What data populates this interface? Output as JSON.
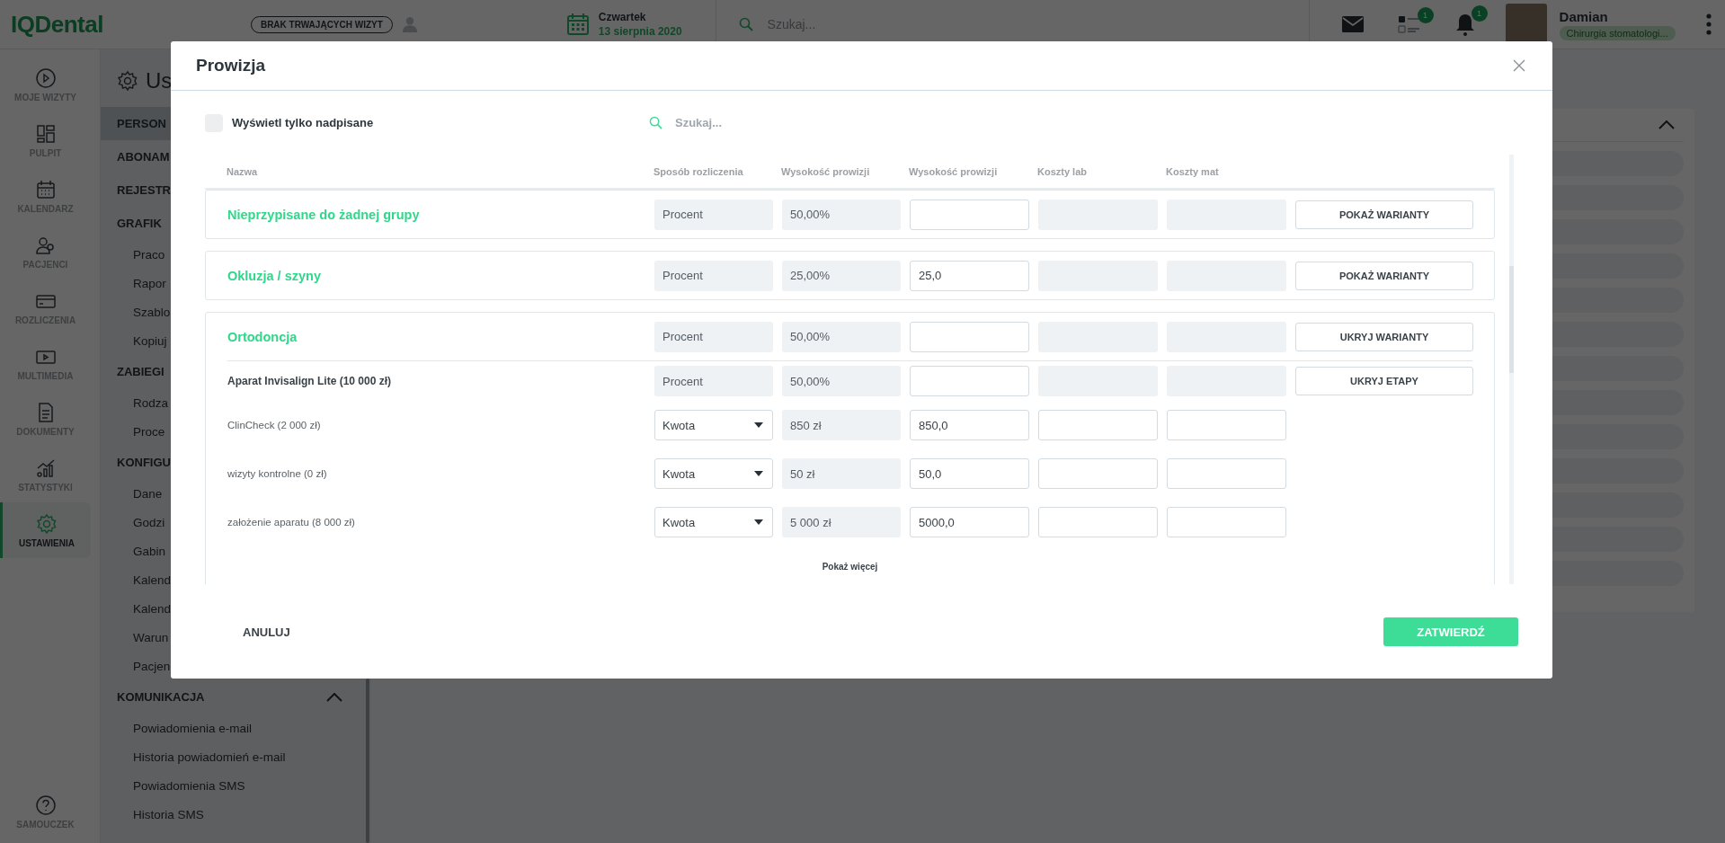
{
  "topbar": {
    "logo": "IQDental",
    "visit_status": "BRAK TRWAJĄCYCH WIZYT",
    "weekday": "Czwartek",
    "date": "13 sierpnia 2020",
    "search": {
      "placeholder": "Szukaj..."
    },
    "tasks_badge": "1",
    "notifications_badge": "1",
    "user": {
      "name": "Damian",
      "role": "Chirurgia stomatologi..."
    }
  },
  "nav": [
    {
      "label": "MOJE WIZYTY",
      "selected": false
    },
    {
      "label": "PULPIT",
      "selected": false
    },
    {
      "label": "KALENDARZ",
      "selected": false
    },
    {
      "label": "PACJENCI",
      "selected": false
    },
    {
      "label": "ROZLICZENIA",
      "selected": false
    },
    {
      "label": "MULTIMEDIA",
      "selected": false
    },
    {
      "label": "DOKUMENTY",
      "selected": false
    },
    {
      "label": "STATYSTYKI",
      "selected": false
    },
    {
      "label": "USTAWIENIA",
      "selected": true
    }
  ],
  "help": {
    "label": "SAMOUCZEK"
  },
  "settings_sidebar": {
    "title": "Us",
    "items": [
      {
        "label": "PERSON",
        "kind": "section",
        "selected": true
      },
      {
        "label": "ABONAM",
        "kind": "section",
        "selected": false
      },
      {
        "label": "REJESTR",
        "kind": "section",
        "selected": false
      },
      {
        "label": "GRAFIK",
        "kind": "section",
        "selected": false
      },
      {
        "label": "Praco",
        "kind": "link",
        "selected": false
      },
      {
        "label": "Rapor",
        "kind": "link",
        "selected": false
      },
      {
        "label": "Szablo",
        "kind": "link",
        "selected": false
      },
      {
        "label": "Kopiuj",
        "kind": "link",
        "selected": false
      },
      {
        "label": "ZABIEGI",
        "kind": "section",
        "selected": false
      },
      {
        "label": "Rodza",
        "kind": "link",
        "selected": false
      },
      {
        "label": "Proce",
        "kind": "link",
        "selected": false
      },
      {
        "label": "KONFIGU",
        "kind": "section",
        "selected": false
      },
      {
        "label": "Dane",
        "kind": "link",
        "selected": false
      },
      {
        "label": "Godzi",
        "kind": "link",
        "selected": false
      },
      {
        "label": "Gabin",
        "kind": "link",
        "selected": false
      },
      {
        "label": "Kalend",
        "kind": "link",
        "selected": false
      },
      {
        "label": "Kalend",
        "kind": "link",
        "selected": false
      },
      {
        "label": "Warun",
        "kind": "link",
        "selected": false
      },
      {
        "label": "Pacjen",
        "kind": "link",
        "selected": false
      },
      {
        "label": "KOMUNIKACJA",
        "kind": "section",
        "selected": false,
        "expanded": true
      },
      {
        "label": "Powiadomienia e-mail",
        "kind": "link",
        "selected": false
      },
      {
        "label": "Historia powiadomień e-mail",
        "kind": "link",
        "selected": false
      },
      {
        "label": "Powiadomienia SMS",
        "kind": "link",
        "selected": false
      },
      {
        "label": "Historia SMS",
        "kind": "link",
        "selected": false
      }
    ]
  },
  "modal": {
    "title": "Prowizja",
    "filter": {
      "label": "Wyświetl tylko nadpisane",
      "checked": false
    },
    "search": {
      "placeholder": "Szukaj..."
    },
    "columns": [
      "Nazwa",
      "Sposób rozliczenia",
      "Wysokość prowizji",
      "Wysokość prowizji",
      "Koszty lab",
      "Koszty mat"
    ],
    "groups": [
      {
        "name": "Nieprzypisane do żadnej grupy",
        "method": "Procent",
        "commission": "50,00%",
        "button": "POKAŻ WARIANTY"
      },
      {
        "name": "Okluzja / szyny",
        "method": "Procent",
        "commission": "25,00%",
        "override": "25,0",
        "button": "POKAŻ WARIANTY"
      },
      {
        "name": "Ortodoncja",
        "method": "Procent",
        "commission": "50,00%",
        "button": "UKRYJ WARIANTY",
        "more": "Pokaż więcej",
        "rows": [
          {
            "kind": "variant",
            "name": "Aparat Invisalign Lite (10 000 zł)",
            "method": "Procent",
            "commission": "50,00%",
            "button": "UKRYJ ETAPY"
          },
          {
            "kind": "stage",
            "name": "ClinCheck (2 000 zł)",
            "method": "Kwota",
            "commission": "850 zł",
            "override": "850,0"
          },
          {
            "kind": "stage",
            "name": "wizyty kontrolne (0 zł)",
            "method": "Kwota",
            "commission": "50 zł",
            "override": "50,0"
          },
          {
            "kind": "stage",
            "name": "założenie aparatu (8 000 zł)",
            "method": "Kwota",
            "commission": "5 000 zł",
            "override": "5000,0"
          }
        ]
      }
    ],
    "cancel": "ANULUJ",
    "confirm": "ZATWIERDŹ"
  }
}
